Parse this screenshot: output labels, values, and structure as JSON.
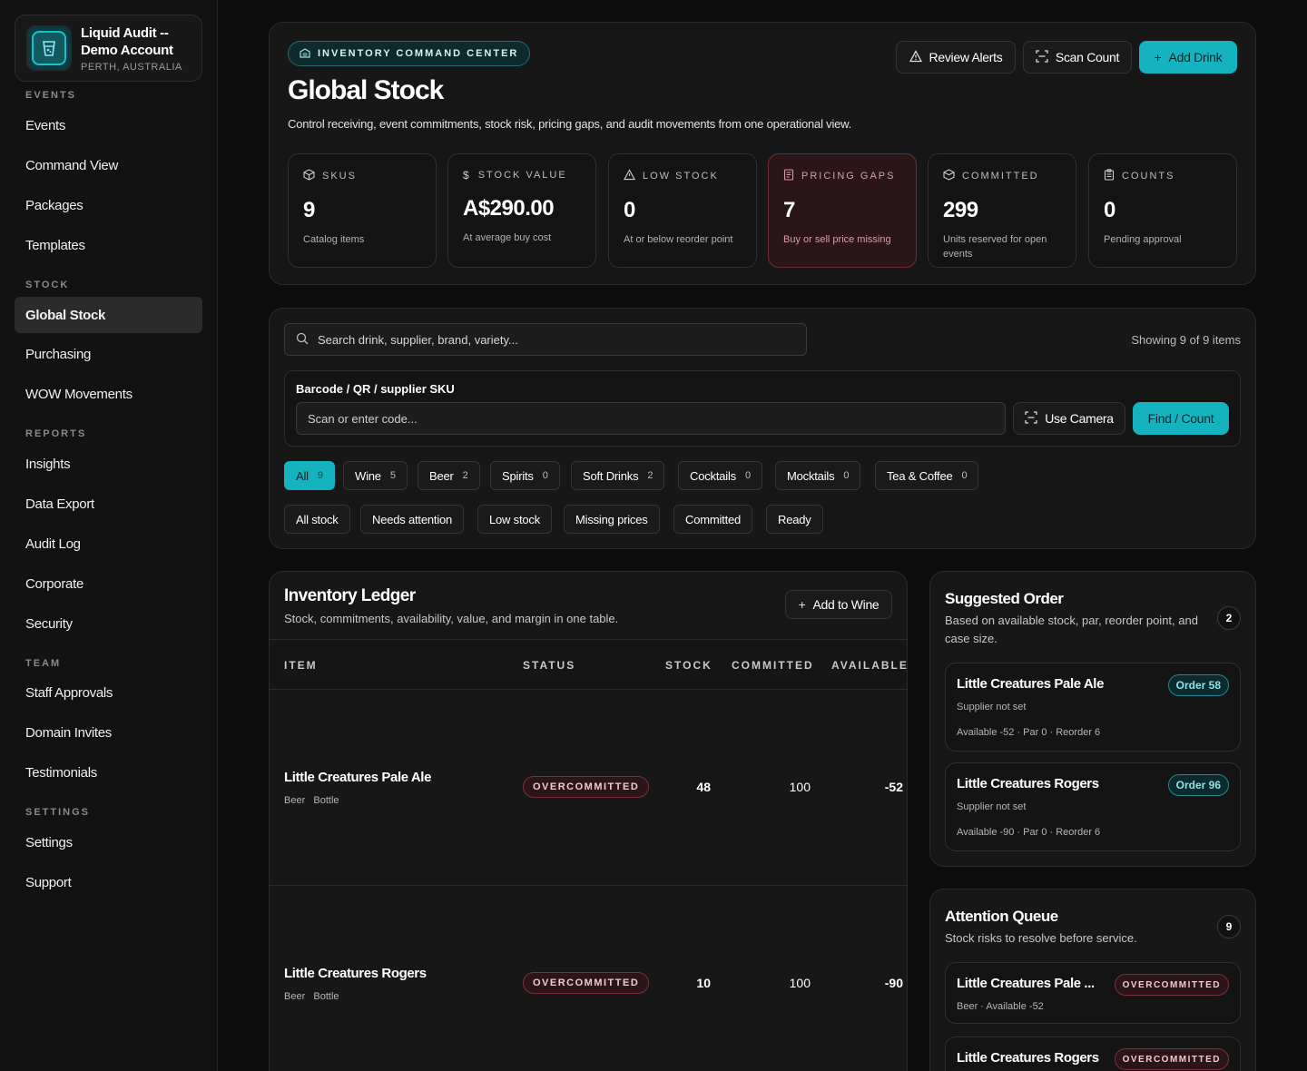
{
  "account": {
    "name_line1": "Liquid Audit --",
    "name_line2": "Demo Account",
    "location": "PERTH, AUSTRALIA"
  },
  "sidebar": {
    "sections": [
      {
        "label": "EVENTS",
        "items": [
          "Events",
          "Command View",
          "Packages",
          "Templates"
        ]
      },
      {
        "label": "STOCK",
        "items": [
          "Global Stock",
          "Purchasing",
          "WOW Movements"
        ]
      },
      {
        "label": "REPORTS",
        "items": [
          "Insights",
          "Data Export",
          "Audit Log",
          "Corporate",
          "Security"
        ]
      },
      {
        "label": "TEAM",
        "items": [
          "Staff Approvals",
          "Domain Invites",
          "Testimonials"
        ]
      },
      {
        "label": "SETTINGS",
        "items": [
          "Settings",
          "Support"
        ]
      }
    ],
    "active_item": "Global Stock"
  },
  "hero": {
    "tag": "INVENTORY COMMAND CENTER",
    "title": "Global Stock",
    "description": "Control receiving, event commitments, stock risk, pricing gaps, and audit movements from one operational view.",
    "buttons": {
      "review_alerts": "Review Alerts",
      "scan_count": "Scan Count",
      "add_drink": "Add Drink"
    },
    "stats": [
      {
        "label": "SKUS",
        "value": "9",
        "sub": "Catalog items",
        "icon": "cube-icon"
      },
      {
        "label": "STOCK VALUE",
        "value": "A$290.00",
        "sub": "At average buy cost",
        "icon": "dollar-icon"
      },
      {
        "label": "LOW STOCK",
        "value": "0",
        "sub": "At or below reorder point",
        "icon": "warning-icon"
      },
      {
        "label": "PRICING GAPS",
        "value": "7",
        "sub": "Buy or sell price missing",
        "icon": "receipt-icon",
        "alert": true
      },
      {
        "label": "COMMITTED",
        "value": "299",
        "sub": "Units reserved for open events",
        "icon": "package-icon"
      },
      {
        "label": "COUNTS",
        "value": "0",
        "sub": "Pending approval",
        "icon": "clipboard-icon"
      }
    ]
  },
  "filters": {
    "search_placeholder": "Search drink, supplier, brand, variety...",
    "showing": "Showing 9 of 9 items",
    "barcode_label": "Barcode / QR / supplier SKU",
    "barcode_placeholder": "Scan or enter code...",
    "use_camera": "Use Camera",
    "find_count": "Find / Count",
    "categories": [
      {
        "label": "All",
        "count": "9",
        "active": true
      },
      {
        "label": "Wine",
        "count": "5"
      },
      {
        "label": "Beer",
        "count": "2"
      },
      {
        "label": "Spirits",
        "count": "0"
      },
      {
        "label": "Soft Drinks",
        "count": "2"
      },
      {
        "label": "Cocktails",
        "count": "0"
      },
      {
        "label": "Mocktails",
        "count": "0"
      },
      {
        "label": "Tea & Coffee",
        "count": "0"
      }
    ],
    "status_filters": [
      "All stock",
      "Needs attention",
      "Low stock",
      "Missing prices",
      "Committed",
      "Ready"
    ]
  },
  "ledger": {
    "title": "Inventory Ledger",
    "subtitle": "Stock, commitments, availability, value, and margin in one table.",
    "add_button": "Add to Wine",
    "columns": [
      "ITEM",
      "STATUS",
      "STOCK",
      "COMMITTED",
      "AVAILABLE"
    ],
    "rows": [
      {
        "name": "Little Creatures Pale Ale",
        "category": "Beer",
        "unit": "Bottle",
        "status": "OVERCOMMITTED",
        "stock": "48",
        "committed": "100",
        "available": "-52"
      },
      {
        "name": "Little Creatures Rogers",
        "category": "Beer",
        "unit": "Bottle",
        "status": "OVERCOMMITTED",
        "stock": "10",
        "committed": "100",
        "available": "-90"
      }
    ]
  },
  "suggested": {
    "title": "Suggested Order",
    "subtitle": "Based on available stock, par, reorder point, and case size.",
    "count": "2",
    "items": [
      {
        "name": "Little Creatures Pale Ale",
        "order": "Order 58",
        "supplier": "Supplier not set",
        "details": "Available -52 · Par 0 · Reorder 6"
      },
      {
        "name": "Little Creatures Rogers",
        "order": "Order 96",
        "supplier": "Supplier not set",
        "details": "Available -90 · Par 0 · Reorder 6"
      }
    ]
  },
  "attention": {
    "title": "Attention Queue",
    "subtitle": "Stock risks to resolve before service.",
    "count": "9",
    "items": [
      {
        "name": "Little Creatures Pale ...",
        "meta": "Beer · Available -52",
        "status": "OVERCOMMITTED"
      },
      {
        "name": "Little Creatures Rogers",
        "meta": "",
        "status": "OVERCOMMITTED"
      }
    ]
  },
  "colors": {
    "accent": "#14b3bf",
    "danger_border": "#7a2f3a",
    "background": "#0d0d0d"
  }
}
